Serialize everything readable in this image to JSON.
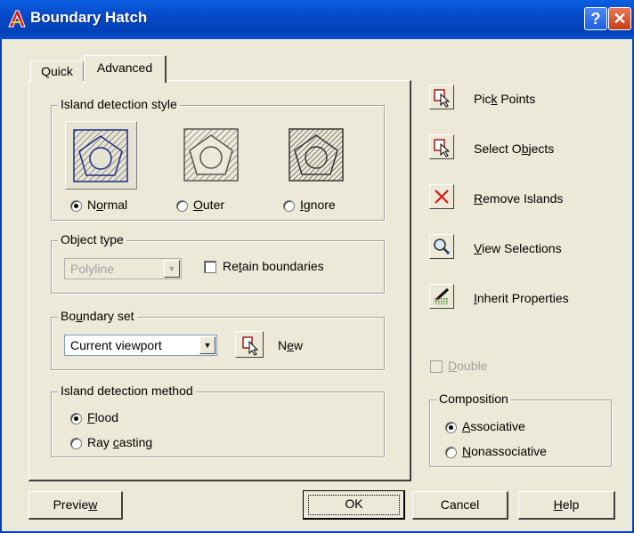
{
  "window": {
    "title": "Boundary Hatch",
    "help_glyph": "?",
    "close_glyph": "✕"
  },
  "tabs": [
    {
      "label": "Quick",
      "selected": false
    },
    {
      "label": "Advanced",
      "selected": true
    }
  ],
  "island_detection_style": {
    "label": "Island detection style",
    "options": [
      {
        "pre": "N",
        "acc": "o",
        "post": "rmal",
        "selected": true
      },
      {
        "pre": "",
        "acc": "O",
        "post": "uter",
        "selected": false
      },
      {
        "pre": "",
        "acc": "I",
        "post": "gnore",
        "selected": false
      }
    ]
  },
  "object_type": {
    "label": "Object type",
    "combo_value": "Polyline",
    "retain_pre": "Re",
    "retain_acc": "t",
    "retain_post": "ain boundaries",
    "retain_checked": false
  },
  "boundary_set": {
    "label_pre": "Bo",
    "label_acc": "u",
    "label_post": "ndary set",
    "combo_value": "Current viewport",
    "new_pre": "N",
    "new_acc": "e",
    "new_post": "w"
  },
  "island_detection_method": {
    "label": "Island detection method",
    "options": [
      {
        "pre": "",
        "acc": "F",
        "post": "lood",
        "selected": true
      },
      {
        "pre": "Ray ",
        "acc": "c",
        "post": "asting",
        "selected": false
      }
    ]
  },
  "actions": [
    {
      "pre": "Pic",
      "acc": "k",
      "post": " Points",
      "icon": "pick-points-icon"
    },
    {
      "pre": "Select O",
      "acc": "b",
      "post": "jects",
      "icon": "select-objects-icon"
    },
    {
      "pre": "",
      "acc": "R",
      "post": "emove Islands",
      "icon": "remove-islands-icon"
    },
    {
      "pre": "",
      "acc": "V",
      "post": "iew Selections",
      "icon": "view-selections-icon"
    },
    {
      "pre": "",
      "acc": "I",
      "post": "nherit Properties",
      "icon": "inherit-properties-icon"
    }
  ],
  "double": {
    "pre": "",
    "acc": "D",
    "post": "ouble",
    "checked": false
  },
  "composition": {
    "label": "Composition",
    "options": [
      {
        "pre": "",
        "acc": "A",
        "post": "ssociative",
        "selected": true
      },
      {
        "pre": "",
        "acc": "N",
        "post": "onassociative",
        "selected": false
      }
    ]
  },
  "buttons": {
    "preview_pre": "Previe",
    "preview_acc": "w",
    "preview_post": "",
    "ok": "OK",
    "cancel": "Cancel",
    "help_pre": "",
    "help_acc": "H",
    "help_post": "elp"
  }
}
